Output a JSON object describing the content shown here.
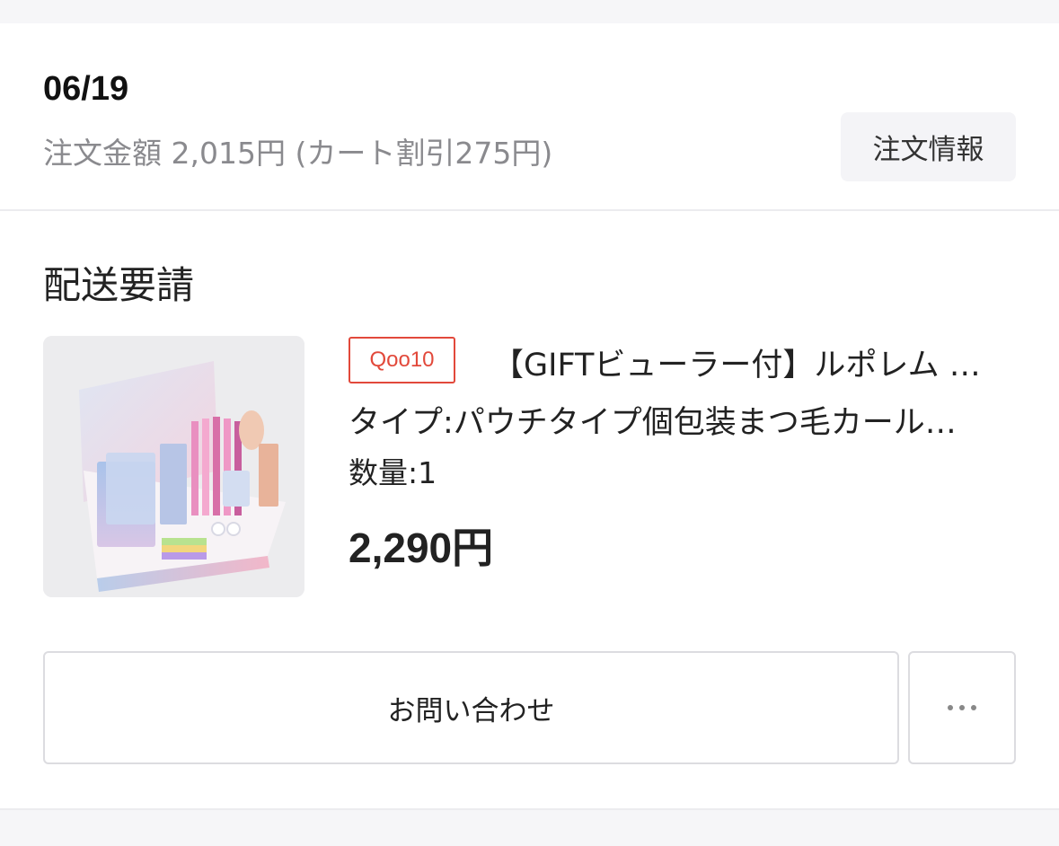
{
  "order": {
    "date": "06/19",
    "amount_text": "注文金額 2,015円 (カート割引275円)",
    "info_button_label": "注文情報"
  },
  "section": {
    "title": "配送要請"
  },
  "item": {
    "thumbnail_icon": "product-photo",
    "shop_badge": "Qoo10",
    "title": "【GIFTビューラー付】ルポレム …",
    "option": "タイプ:パウチタイプ個包装まつ毛カール…",
    "quantity": "数量:1",
    "price": "2,290円"
  },
  "actions": {
    "contact_label": "お問い合わせ",
    "more_icon": "more-horizontal-icon"
  },
  "colors": {
    "badge_red": "#e2493b",
    "muted_text": "#8a8a8e",
    "button_bg": "#f4f4f7"
  }
}
